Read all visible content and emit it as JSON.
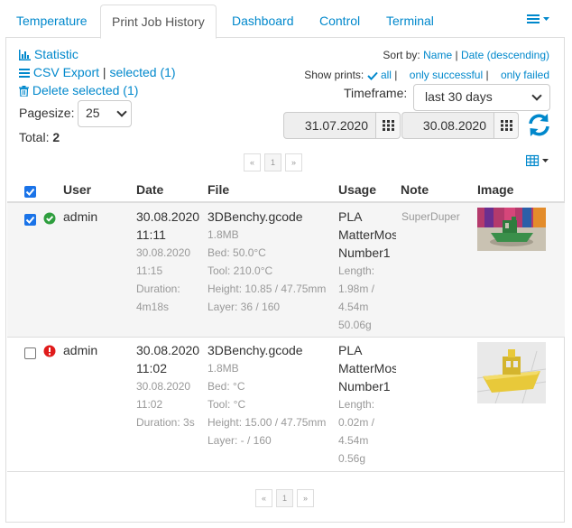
{
  "tabs": [
    {
      "label": "Temperature"
    },
    {
      "label": "Print Job History"
    },
    {
      "label": "Dashboard"
    },
    {
      "label": "Control"
    },
    {
      "label": "Terminal"
    }
  ],
  "toolbar": {
    "statistic_label": "Statistic",
    "csv_export_label": "CSV Export",
    "csv_separator": "|",
    "csv_selected_label": "selected (1)",
    "delete_selected_label": "Delete selected (1)",
    "pagesize_label": "Pagesize:",
    "pagesize_value": "25",
    "total_label": "Total:",
    "total_value": "2"
  },
  "sort": {
    "label": "Sort by:",
    "name": "Name",
    "sep": "|",
    "date": "Date (descending)"
  },
  "show_prints": {
    "label": "Show prints:",
    "all": "all",
    "sep1": "|",
    "only_successful": "only successful",
    "sep2": "|",
    "only_failed": "only failed"
  },
  "timeframe": {
    "label": "Timeframe:",
    "value": "last 30 days",
    "from_date": "31.07.2020",
    "to_date": "30.08.2020"
  },
  "pager": {
    "prev": "«",
    "page": "1",
    "next": "»"
  },
  "table": {
    "headers": {
      "user": "User",
      "date": "Date",
      "file": "File",
      "usage": "Usage",
      "note": "Note",
      "image": "Image"
    },
    "rows": [
      {
        "status": "success",
        "status_color": "#2e9e3e",
        "user": "admin",
        "date_start": "30.08.2020",
        "time_start": "11:11",
        "date_end": "30.08.2020",
        "time_end": "11:15",
        "duration": "Duration:",
        "duration_value": "4m18s",
        "file": "3DBenchy.gcode",
        "size": "1.8MB",
        "bed": "Bed: 50.0°C",
        "tool": "Tool: 210.0°C",
        "height": "Height: 10.85 / 47.75mm",
        "layer": "Layer: 36 / 160",
        "usage_material": "PLA",
        "usage_vendor": "MatterMost",
        "usage_spool": "Number1",
        "usage_length_label": "Length:",
        "usage_length": "1.98m /",
        "usage_length_total": "4.54m",
        "usage_weight": "50.06g",
        "note": "SuperDuper"
      },
      {
        "status": "failed",
        "status_color": "#e01b1b",
        "user": "admin",
        "date_start": "30.08.2020",
        "time_start": "11:02",
        "date_end": "30.08.2020",
        "time_end": "11:02",
        "duration": "Duration: 3s",
        "file": "3DBenchy.gcode",
        "size": "1.8MB",
        "bed": "Bed: °C",
        "tool": "Tool: °C",
        "height": "Height: 15.00 / 47.75mm",
        "layer": "Layer: - / 160",
        "usage_material": "PLA",
        "usage_vendor": "MatterMost",
        "usage_spool": "Number1",
        "usage_length_label": "Length:",
        "usage_length": "0.02m /",
        "usage_length_total": "4.54m",
        "usage_weight": "0.56g",
        "note": ""
      }
    ]
  },
  "colors": {
    "link": "#0088cc",
    "muted": "#999999",
    "checkbox": "#1a73e8",
    "boat_green": "#3a8f4a",
    "boat_yellow": "#e8c93a"
  }
}
